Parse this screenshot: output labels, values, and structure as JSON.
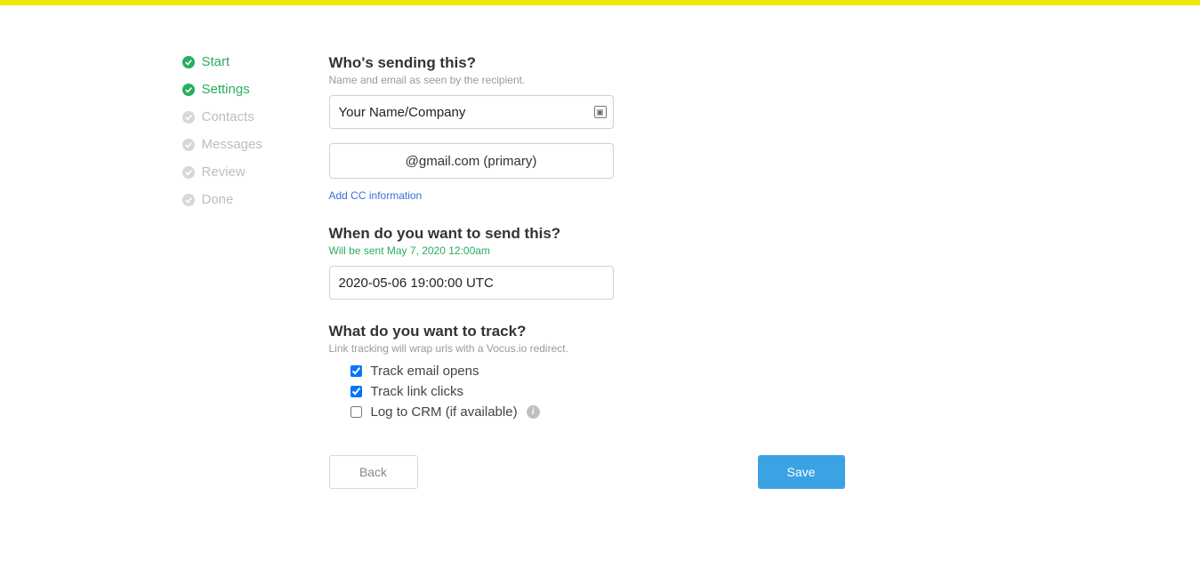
{
  "steps": [
    {
      "label": "Start",
      "status": "complete"
    },
    {
      "label": "Settings",
      "status": "complete"
    },
    {
      "label": "Contacts",
      "status": "pending"
    },
    {
      "label": "Messages",
      "status": "pending"
    },
    {
      "label": "Review",
      "status": "pending"
    },
    {
      "label": "Done",
      "status": "pending"
    }
  ],
  "sender": {
    "title": "Who's sending this?",
    "subtitle": "Name and email as seen by the recipient.",
    "name_value": "Your Name/Company",
    "email_display": "@gmail.com (primary)",
    "cc_link": "Add CC information"
  },
  "schedule": {
    "title": "When do you want to send this?",
    "note": "Will be sent May 7, 2020 12:00am",
    "value": "2020-05-06 19:00:00 UTC"
  },
  "tracking": {
    "title": "What do you want to track?",
    "subtitle": "Link tracking will wrap urls with a Vocus.io redirect.",
    "opens_label": "Track email opens",
    "clicks_label": "Track link clicks",
    "crm_label": "Log to CRM (if available)",
    "opens_checked": true,
    "clicks_checked": true,
    "crm_checked": false
  },
  "buttons": {
    "back": "Back",
    "save": "Save"
  }
}
